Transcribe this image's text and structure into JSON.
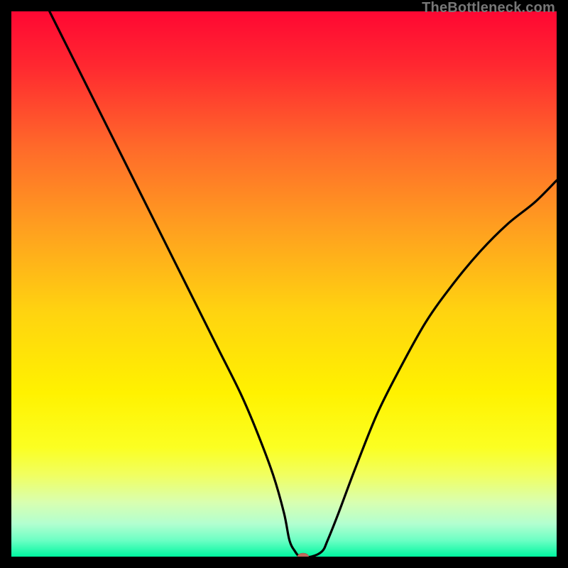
{
  "watermark": "TheBottleneck.com",
  "chart_data": {
    "type": "line",
    "title": "",
    "xlabel": "",
    "ylabel": "",
    "xlim": [
      0,
      100
    ],
    "ylim": [
      0,
      100
    ],
    "background_gradient": {
      "stops": [
        {
          "offset": 0.0,
          "color": "#ff0733"
        },
        {
          "offset": 0.1,
          "color": "#ff2830"
        },
        {
          "offset": 0.25,
          "color": "#ff6a2a"
        },
        {
          "offset": 0.4,
          "color": "#ffa01f"
        },
        {
          "offset": 0.55,
          "color": "#ffd310"
        },
        {
          "offset": 0.7,
          "color": "#fff200"
        },
        {
          "offset": 0.8,
          "color": "#fbff22"
        },
        {
          "offset": 0.85,
          "color": "#f1ff60"
        },
        {
          "offset": 0.9,
          "color": "#d9ffb0"
        },
        {
          "offset": 0.94,
          "color": "#b2ffd0"
        },
        {
          "offset": 0.97,
          "color": "#6cffc4"
        },
        {
          "offset": 1.0,
          "color": "#00f7a0"
        }
      ]
    },
    "series": [
      {
        "name": "bottleneck-curve",
        "x": [
          7,
          10,
          14,
          18,
          22,
          26,
          30,
          34,
          38,
          42,
          45,
          48,
          50,
          51,
          52,
          53,
          55,
          57,
          58,
          60,
          63,
          67,
          71,
          76,
          81,
          86,
          91,
          96,
          100
        ],
        "y": [
          100,
          94,
          86,
          78,
          70,
          62,
          54,
          46,
          38,
          30,
          23,
          15,
          8,
          3,
          1,
          0,
          0,
          1,
          3,
          8,
          16,
          26,
          34,
          43,
          50,
          56,
          61,
          65,
          69
        ]
      }
    ],
    "marker": {
      "name": "optimal-point",
      "x": 53.5,
      "y": 0,
      "color": "#c0685c",
      "rx": 8,
      "ry": 5
    }
  }
}
